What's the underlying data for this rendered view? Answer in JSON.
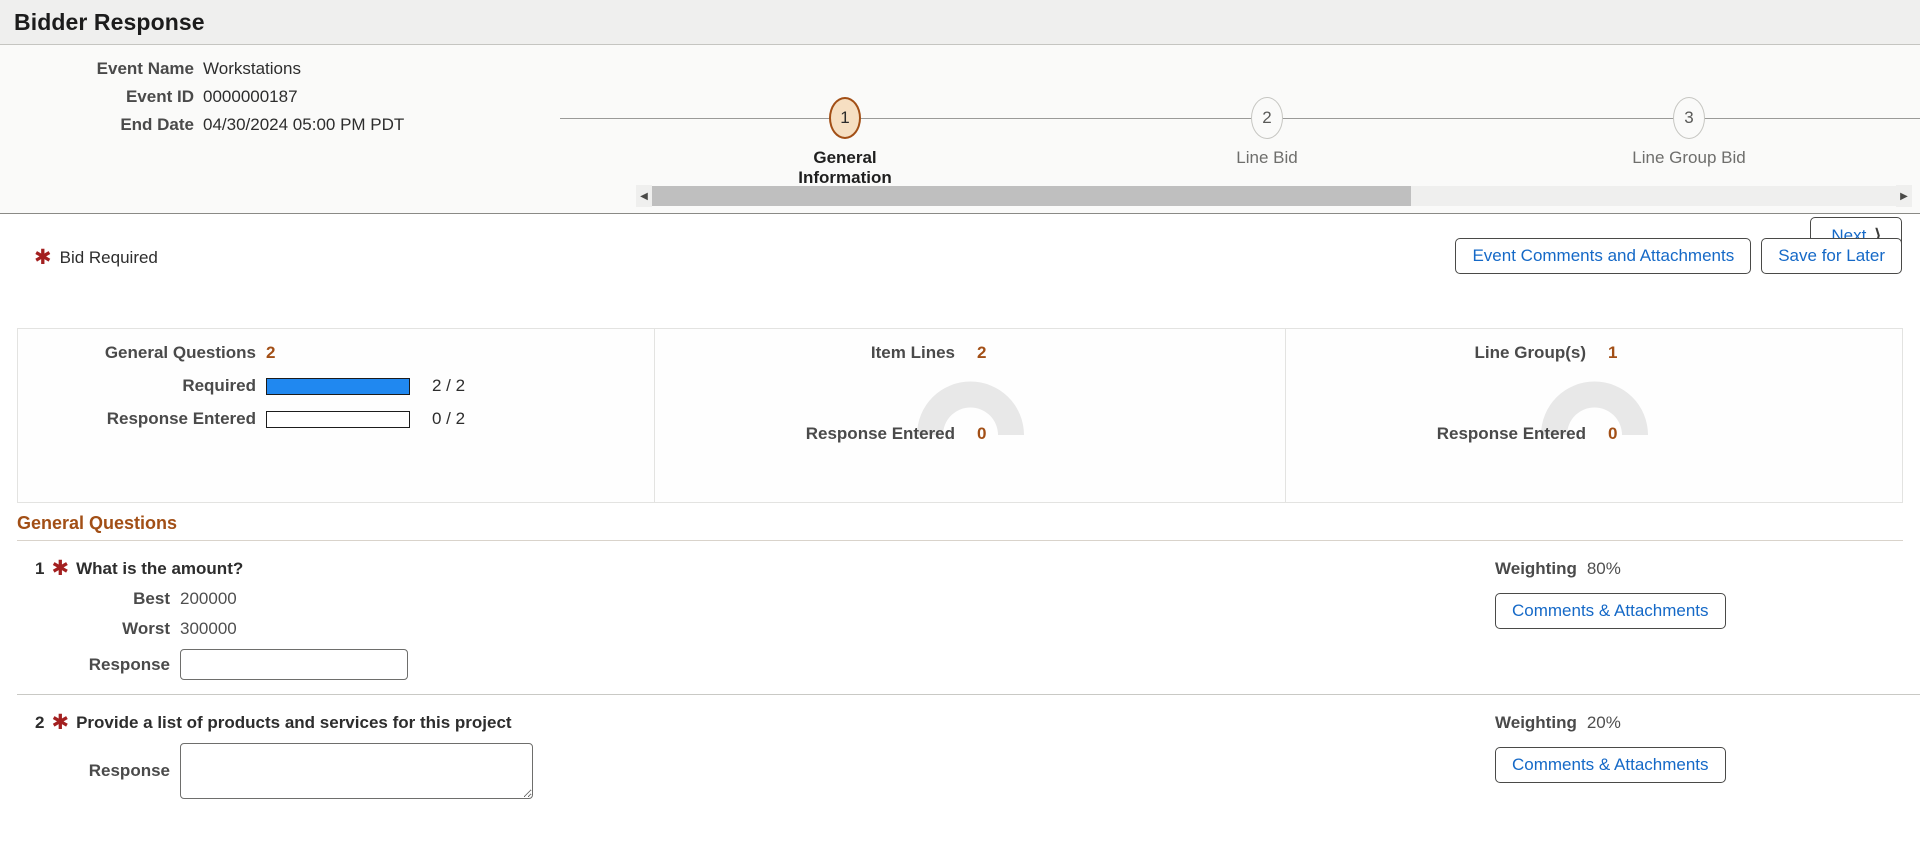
{
  "window": {
    "title": "Bidder Response"
  },
  "event": {
    "fields": [
      {
        "label": "Event Name",
        "value": "Workstations"
      },
      {
        "label": "Event ID",
        "value": "0000000187"
      },
      {
        "label": "End Date",
        "value": "04/30/2024 05:00 PM PDT"
      }
    ]
  },
  "stepper": {
    "steps": [
      {
        "number": "1",
        "label": "General Information",
        "active": true
      },
      {
        "number": "2",
        "label": "Line Bid",
        "active": false
      },
      {
        "number": "3",
        "label": "Line Group Bid",
        "active": false
      }
    ],
    "scroll_left_icon": "triangle-left-icon",
    "scroll_right_icon": "triangle-right-icon"
  },
  "toolbar": {
    "next_label": "Next",
    "next_chevron": "chevron-right-icon",
    "bid_required_label": "Bid Required",
    "required_star": "required-asterisk-icon",
    "event_comments_label": "Event Comments and Attachments",
    "save_for_later_label": "Save for Later"
  },
  "summary": {
    "general_questions": {
      "title": "General Questions",
      "count": "2",
      "rows": [
        {
          "label": "Required",
          "value": "2 / 2",
          "percent": 100,
          "filled": true
        },
        {
          "label": "Response Entered",
          "value": "0 / 2",
          "percent": 0,
          "filled": false
        }
      ]
    },
    "item_lines": {
      "title": "Item Lines",
      "count": "2",
      "response_label": "Response Entered",
      "response_value": "0",
      "gauge_percent": 0
    },
    "line_groups": {
      "title": "Line Group(s)",
      "count": "1",
      "response_label": "Response Entered",
      "response_value": "0",
      "gauge_percent": 0
    }
  },
  "section": {
    "heading": "General Questions",
    "questions": [
      {
        "number": "1",
        "text": "What is the amount?",
        "best_label": "Best",
        "best_value": "200000",
        "worst_label": "Worst",
        "worst_value": "300000",
        "response_label": "Response",
        "response_value": "",
        "weighting_label": "Weighting",
        "weighting_value": "80%",
        "comments_label": "Comments & Attachments"
      },
      {
        "number": "2",
        "text": "Provide a list of products and services for this project",
        "response_label": "Response",
        "response_value": "",
        "weighting_label": "Weighting",
        "weighting_value": "20%",
        "comments_label": "Comments & Attachments"
      }
    ]
  },
  "colors": {
    "accent_brown": "#a24f16",
    "link_blue": "#1569c7",
    "progress_blue": "#2088f0",
    "required_red": "#a32020",
    "gauge_gray": "#e8e8e8"
  }
}
